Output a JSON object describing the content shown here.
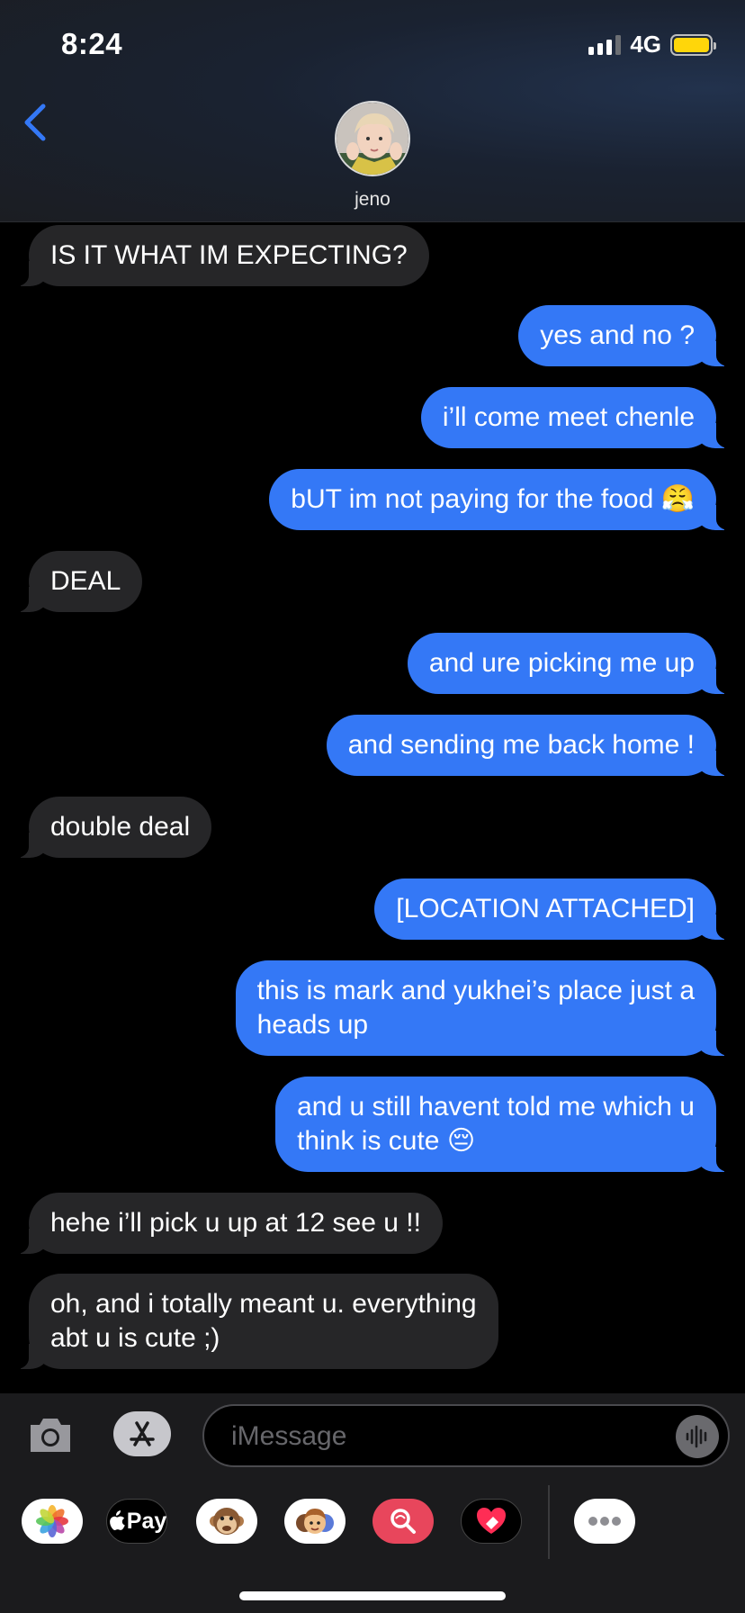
{
  "status_bar": {
    "time": "8:24",
    "network": "4G",
    "signal_bars": 3,
    "battery_color": "#ffd60a"
  },
  "header": {
    "back_icon": "chevron-left-icon",
    "contact_name": "jeno"
  },
  "colors": {
    "outgoing_bubble": "#3478f6",
    "incoming_bubble": "#262628",
    "accent": "#3478f6"
  },
  "messages": [
    {
      "direction": "in",
      "text": "IS IT WHAT IM EXPECTING?"
    },
    {
      "direction": "out",
      "text": "yes and no ?"
    },
    {
      "direction": "out",
      "text": "i’ll come meet chenle"
    },
    {
      "direction": "out",
      "text": "bUT im not paying for the food 😤"
    },
    {
      "direction": "in",
      "text": "DEAL"
    },
    {
      "direction": "out",
      "text": "and ure picking me up"
    },
    {
      "direction": "out",
      "text": "and sending me back home !"
    },
    {
      "direction": "in",
      "text": "double deal"
    },
    {
      "direction": "out",
      "text": "[LOCATION ATTACHED]"
    },
    {
      "direction": "out",
      "text": "this is mark and yukhei’s place just a\nheads up"
    },
    {
      "direction": "out",
      "text": "and u still havent told me which u\nthink is cute 😔"
    },
    {
      "direction": "in",
      "text": "hehe i’ll pick u up at 12 see u !!"
    },
    {
      "direction": "in",
      "text": "oh, and i totally meant u. everything\nabt u is cute ;)"
    }
  ],
  "input_bar": {
    "placeholder": "iMessage",
    "camera_icon": "camera-icon",
    "appstore_icon": "app-store-icon",
    "audio_icon": "audio-waveform-icon"
  },
  "app_drawer": [
    {
      "name": "photos-icon"
    },
    {
      "name": "apple-pay-icon",
      "label": "Pay"
    },
    {
      "name": "animoji-icon"
    },
    {
      "name": "memoji-icon"
    },
    {
      "name": "image-search-icon"
    },
    {
      "name": "digital-touch-icon"
    },
    {
      "name": "more-apps-icon"
    }
  ]
}
